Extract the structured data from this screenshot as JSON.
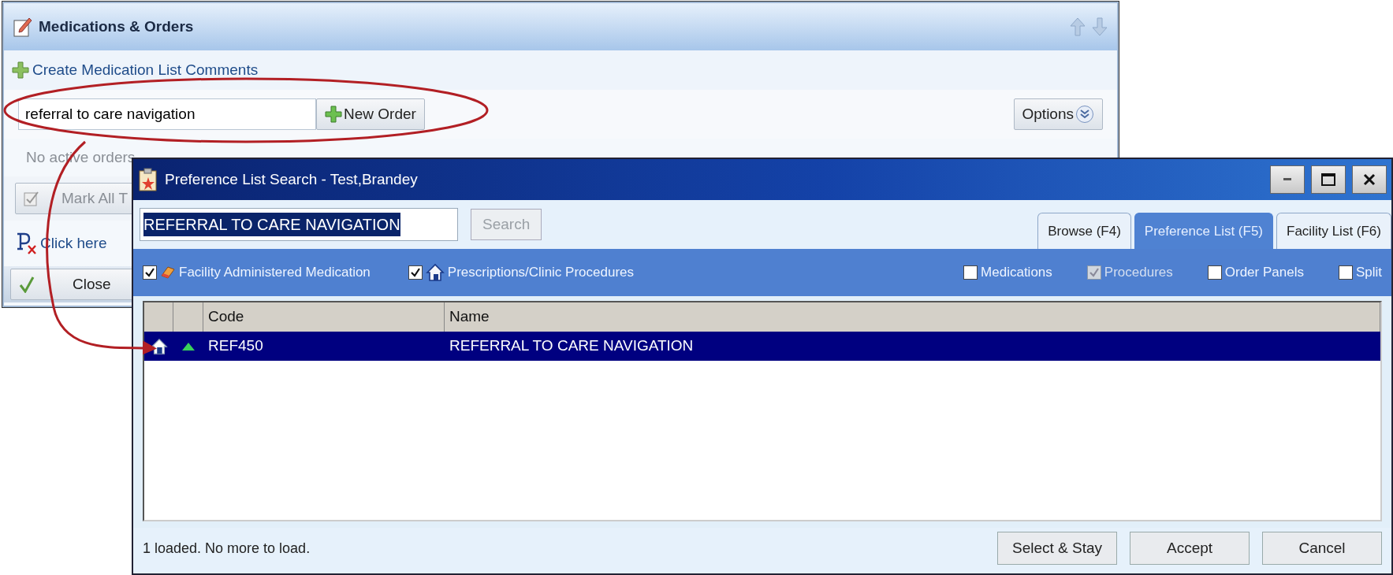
{
  "back_panel": {
    "title": "Medications & Orders",
    "create_link": "Create Medication List Comments",
    "order_search": {
      "value": "referral to care navigation"
    },
    "new_order_button": "New Order",
    "options_button": "Options",
    "empty_message": "No active orders",
    "mark_all_button": "Mark All T",
    "prescription_link": "Click here",
    "close_button": "Close"
  },
  "dialog": {
    "title": "Preference List Search - Test,Brandey",
    "search": {
      "value": "REFERRAL TO CARE NAVIGATION",
      "selected": true
    },
    "search_button": {
      "label": "Search",
      "disabled": true
    },
    "tabs": [
      {
        "label": "Browse (F4)",
        "selected": false
      },
      {
        "label": "Preference List (F5)",
        "selected": true
      },
      {
        "label": "Facility List (F6)",
        "selected": false
      }
    ],
    "filters_left": [
      {
        "label": "Facility Administered Medication",
        "checked": true,
        "disabled": false,
        "kind": "medication"
      },
      {
        "label": "Prescriptions/Clinic Procedures",
        "checked": true,
        "disabled": false,
        "kind": "clinic"
      }
    ],
    "filters_right": [
      {
        "label": "Medications",
        "checked": false,
        "disabled": false
      },
      {
        "label": "Procedures",
        "checked": true,
        "disabled": true
      },
      {
        "label": "Order Panels",
        "checked": false,
        "disabled": false
      },
      {
        "label": "Split",
        "checked": false,
        "disabled": false
      }
    ],
    "table": {
      "columns": [
        "Code",
        "Name"
      ],
      "rows": [
        {
          "code": "REF450",
          "name": "REFERRAL TO CARE NAVIGATION",
          "selected": true
        }
      ]
    },
    "status": "1 loaded. No more to load.",
    "buttons": [
      "Select & Stay",
      "Accept",
      "Cancel"
    ]
  }
}
